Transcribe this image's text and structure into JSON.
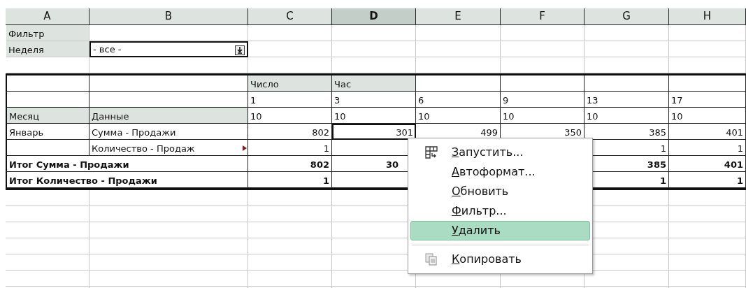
{
  "columns": [
    {
      "label": "A",
      "selected": false
    },
    {
      "label": "B",
      "selected": false
    },
    {
      "label": "C",
      "selected": false
    },
    {
      "label": "D",
      "selected": true
    },
    {
      "label": "E",
      "selected": false
    },
    {
      "label": "F",
      "selected": false
    },
    {
      "label": "G",
      "selected": false
    },
    {
      "label": "H",
      "selected": false
    }
  ],
  "rows": [
    {
      "cells": [
        {
          "text": "Фильтр",
          "kind": "field"
        },
        null,
        null,
        null,
        null,
        null,
        null,
        null
      ]
    },
    {
      "cells": [
        {
          "text": "Неделя",
          "kind": "field"
        },
        {
          "text": "- все -",
          "kind": "dropdown"
        },
        null,
        null,
        null,
        null,
        null,
        null
      ]
    },
    {
      "cells": [
        null,
        null,
        null,
        null,
        null,
        null,
        null,
        null
      ]
    },
    {
      "cells": [
        null,
        null,
        {
          "text": "Число",
          "kind": "field"
        },
        {
          "text": "Час",
          "kind": "field"
        },
        null,
        null,
        null,
        null
      ]
    },
    {
      "cells": [
        null,
        null,
        {
          "text": "1",
          "kind": "text"
        },
        {
          "text": "3",
          "kind": "text"
        },
        {
          "text": "6",
          "kind": "text"
        },
        {
          "text": "9",
          "kind": "text"
        },
        {
          "text": "13",
          "kind": "text"
        },
        {
          "text": "17",
          "kind": "text"
        }
      ]
    },
    {
      "cells": [
        {
          "text": "Месяц",
          "kind": "field"
        },
        {
          "text": "Данные",
          "kind": "field"
        },
        {
          "text": "10",
          "kind": "text"
        },
        {
          "text": "10",
          "kind": "text"
        },
        {
          "text": "10",
          "kind": "text"
        },
        {
          "text": "10",
          "kind": "text"
        },
        {
          "text": "10",
          "kind": "text"
        },
        {
          "text": "10",
          "kind": "text"
        }
      ]
    },
    {
      "cells": [
        {
          "text": "Январь",
          "kind": "text"
        },
        {
          "text": "Сумма - Продажи",
          "kind": "text"
        },
        {
          "text": "802",
          "kind": "number"
        },
        {
          "text": "301",
          "kind": "number",
          "selected": true
        },
        {
          "text": "499",
          "kind": "number"
        },
        {
          "text": "350",
          "kind": "number"
        },
        {
          "text": "385",
          "kind": "number"
        },
        {
          "text": "401",
          "kind": "number"
        }
      ]
    },
    {
      "cells": [
        null,
        {
          "text": "Количество - Продаж",
          "kind": "overflow"
        },
        {
          "text": "1",
          "kind": "number"
        },
        null,
        null,
        null,
        {
          "text": "1",
          "kind": "number"
        },
        {
          "text": "1",
          "kind": "number"
        }
      ]
    },
    {
      "cells": [
        {
          "text": "Итог Сумма - Продажи",
          "kind": "total_label"
        },
        {
          "text": "802",
          "kind": "total_number"
        },
        {
          "text": "30",
          "kind": "covered_total"
        },
        null,
        null,
        {
          "text": "385",
          "kind": "total_number"
        },
        {
          "text": "401",
          "kind": "total_number"
        }
      ]
    },
    {
      "cells": [
        {
          "text": "Итог Количество - Продажи",
          "kind": "total_label"
        },
        {
          "text": "1",
          "kind": "total_number"
        },
        null,
        null,
        null,
        {
          "text": "1",
          "kind": "total_number"
        },
        {
          "text": "1",
          "kind": "total_number"
        }
      ]
    }
  ],
  "context_menu": [
    {
      "kind": "item",
      "label": "Запустить...",
      "selected": false
    },
    {
      "kind": "item",
      "label": "Автоформат...",
      "selected": false
    },
    {
      "kind": "item",
      "label": "Обновить",
      "selected": false
    },
    {
      "kind": "item",
      "label": "Фильтр...",
      "selected": false
    },
    {
      "kind": "item",
      "label": "Удалить",
      "selected": true
    },
    {
      "kind": "separator"
    },
    {
      "kind": "item",
      "label": "Копировать",
      "selected": false
    }
  ]
}
